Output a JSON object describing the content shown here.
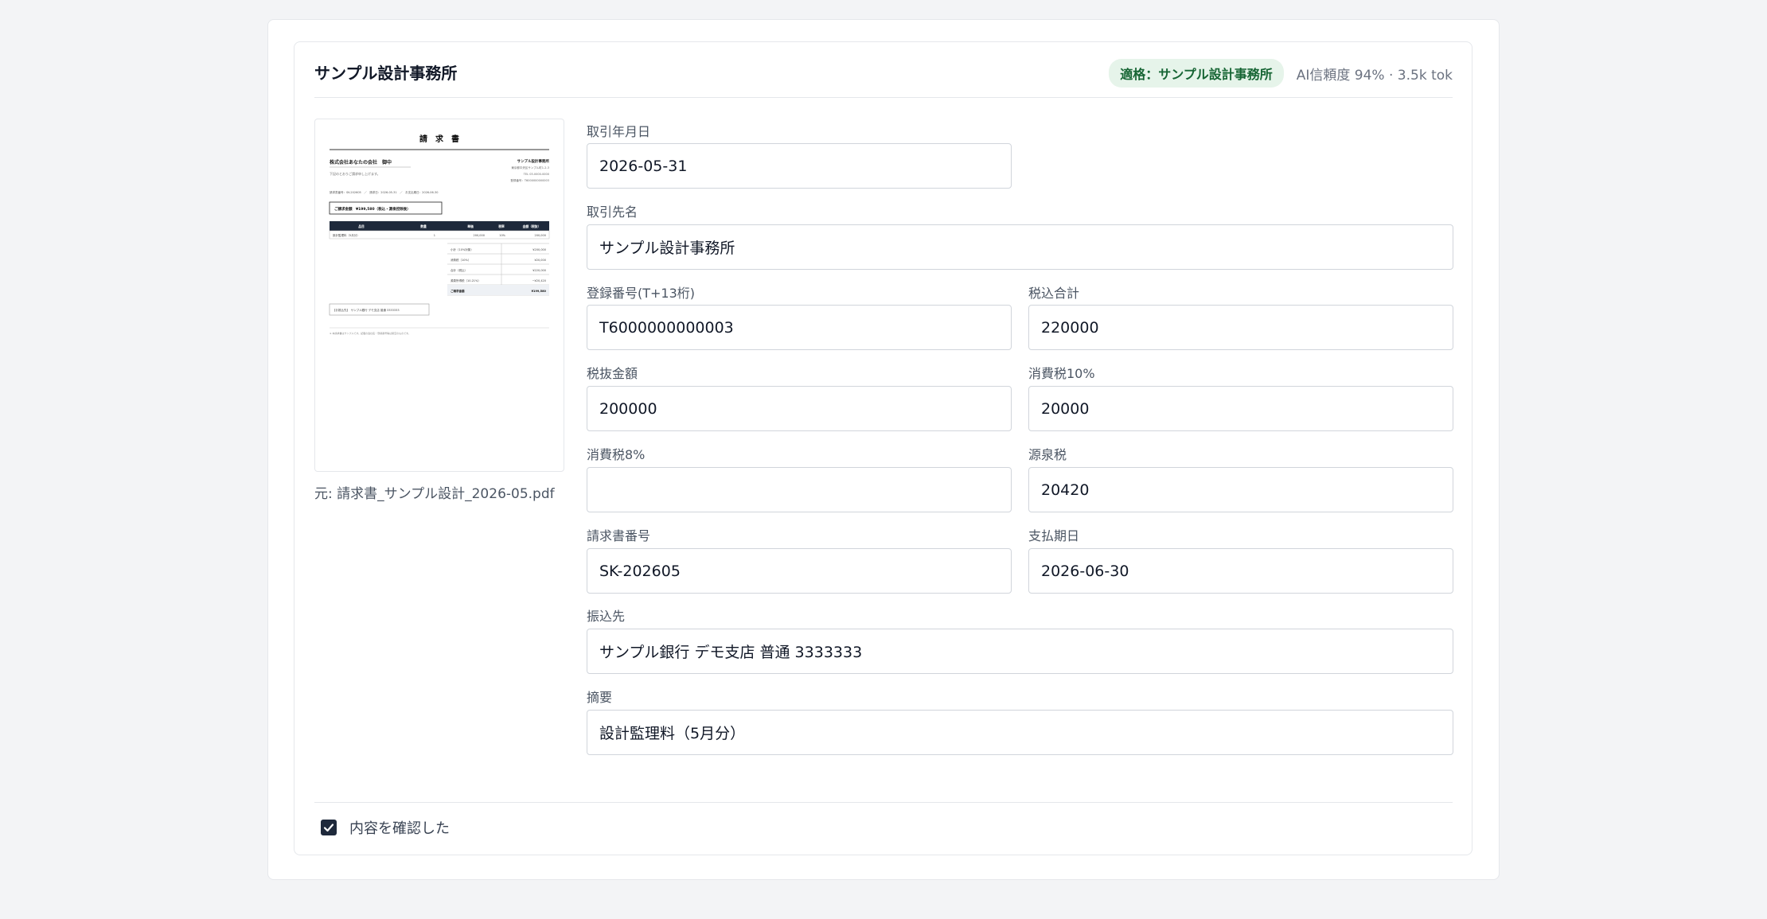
{
  "header": {
    "vendor_title": "サンプル設計事務所",
    "match_badge": "適格：サンプル設計事務所",
    "confidence": "AI信頼度 94% · 3.5k tok"
  },
  "preview": {
    "doc_title": "請　求　書",
    "recipient": "株式会社あなたの会社　御中",
    "recipient_note": "下記のとおりご請求申し上げます。",
    "issuer": "サンプル設計事務所",
    "issuer_address": "東京都中央区サンプル町1-2-3",
    "issuer_tel": "TEL 03-0000-0000",
    "issuer_reg": "登録番号：T6000000000003",
    "meta_line": "請求書番号：SK-202605　／　請求日：2026-05-31　／　お支払期日：2026-06-30",
    "amount_box": "ご請求金額　¥199,580（税込・源泉控除後）",
    "table_headers": [
      "品目",
      "数量",
      "単価",
      "税率",
      "金額（税抜）"
    ],
    "row": [
      "設計監理料（5月分）",
      "1",
      "200,000",
      "10%",
      "200,000"
    ],
    "summary": [
      {
        "label": "小計（10%対象）",
        "value": "¥200,000"
      },
      {
        "label": "消費税（10%）",
        "value": "¥20,000"
      },
      {
        "label": "合計（税込）",
        "value": "¥220,000"
      },
      {
        "label": "源泉所得税（10.21%）",
        "value": "−¥20,420"
      },
      {
        "label": "ご請求金額",
        "value": "¥199,580"
      }
    ],
    "bank_note": "【お振込先】　サンプル銀行 デモ支店 普通 3333333",
    "footnote": "※ 本請求書はサンプルです。記載の会社名・登録番号等は架空のものです。"
  },
  "source_caption": "元: 請求書_サンプル設計_2026-05.pdf",
  "fields": {
    "transaction_date": {
      "label": "取引年月日",
      "value": "2026-05-31"
    },
    "vendor_name": {
      "label": "取引先名",
      "value": "サンプル設計事務所"
    },
    "registration_number": {
      "label": "登録番号(T+13桁)",
      "value": "T6000000000003"
    },
    "total_incl_tax": {
      "label": "税込合計",
      "value": "220000"
    },
    "amount_excl_tax": {
      "label": "税抜金額",
      "value": "200000"
    },
    "consumption_tax_10": {
      "label": "消費税10%",
      "value": "20000"
    },
    "consumption_tax_8": {
      "label": "消費税8%",
      "value": ""
    },
    "withholding_tax": {
      "label": "源泉税",
      "value": "20420"
    },
    "invoice_number": {
      "label": "請求書番号",
      "value": "SK-202605"
    },
    "payment_due": {
      "label": "支払期日",
      "value": "2026-06-30"
    },
    "bank_account": {
      "label": "振込先",
      "value": "サンプル銀行 デモ支店 普通 3333333"
    },
    "memo": {
      "label": "摘要",
      "value": "設計監理料（5月分）"
    }
  },
  "confirm": {
    "label": "内容を確認した",
    "checked": true
  },
  "colors": {
    "accent_dark": "#1e293b",
    "badge_bg": "#e6f4ea",
    "badge_text": "#166534"
  }
}
